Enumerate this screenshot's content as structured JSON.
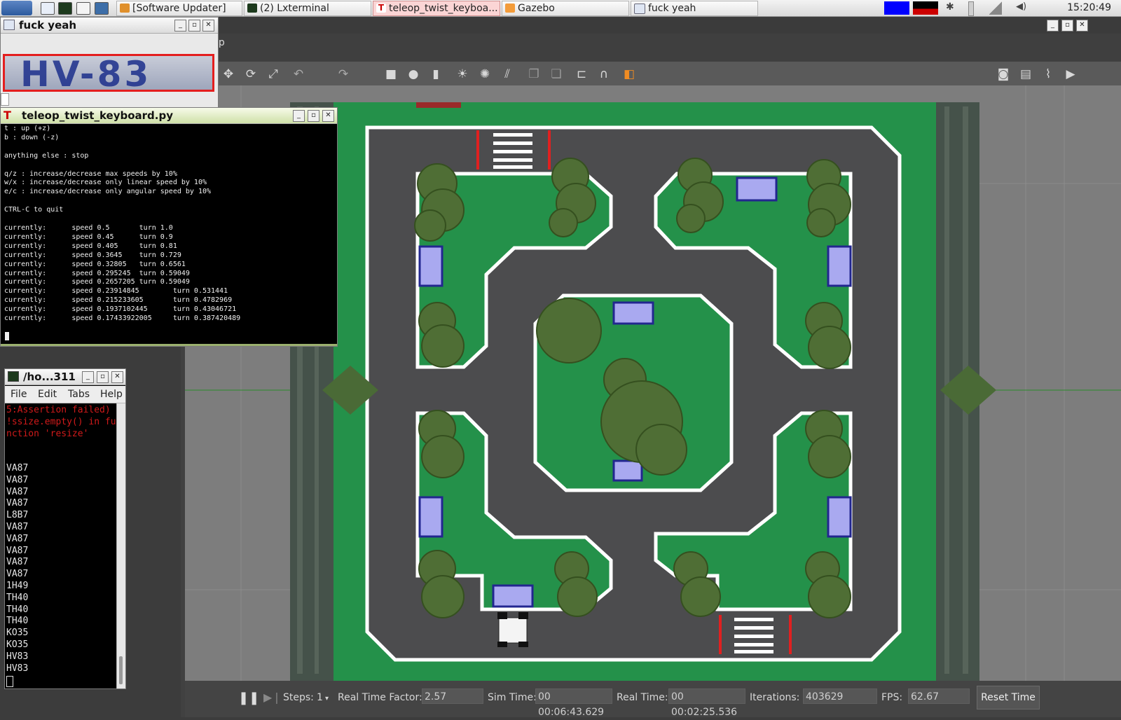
{
  "taskbar": {
    "tasks": [
      {
        "label": "[Software Updater]"
      },
      {
        "label": "(2) Lxterminal"
      },
      {
        "label": "teleop_twist_keyboa..."
      },
      {
        "label": "Gazebo"
      },
      {
        "label": "fuck yeah"
      }
    ],
    "clock": "15:20:49"
  },
  "fy_window": {
    "title": "fuck yeah",
    "plate": "HV-83"
  },
  "teleop": {
    "title": "teleop_twist_keyboard.py",
    "lines": "t : up (+z)\nb : down (-z)\n\nanything else : stop\n\nq/z : increase/decrease max speeds by 10%\nw/x : increase/decrease only linear speed by 10%\ne/c : increase/decrease only angular speed by 10%\n\nCTRL-C to quit\n\ncurrently:      speed 0.5       turn 1.0\ncurrently:      speed 0.45      turn 0.9\ncurrently:      speed 0.405     turn 0.81\ncurrently:      speed 0.3645    turn 0.729\ncurrently:      speed 0.32805   turn 0.6561\ncurrently:      speed 0.295245  turn 0.59049\ncurrently:      speed 0.2657205 turn 0.59049\ncurrently:      speed 0.23914845        turn 0.531441\ncurrently:      speed 0.215233605       turn 0.4782969\ncurrently:      speed 0.1937102445      turn 0.43046721\ncurrently:      speed 0.17433922005     turn 0.387420489"
  },
  "term2": {
    "title": "/ho...311",
    "menu": {
      "file": "File",
      "edit": "Edit",
      "tabs": "Tabs",
      "help": "Help"
    },
    "error": "5:Assertion failed)\n!ssize.empty() in fu\nnction 'resize'",
    "plates": "VA87\nVA87\nVA87\nVA87\nL8B7\nVA87\nVA87\nVA87\nVA87\nVA87\n1H49\nTH40\nTH40\nTH40\nKO35\nKO35\nHV83\nHV83"
  },
  "gazebo": {
    "menu_partial": "lp",
    "steps_label": "Steps:",
    "steps_value": "1",
    "rtf_label": "Real Time Factor:",
    "rtf_value": "2.57",
    "sim_label": "Sim Time:",
    "sim_value": "00 00:06:43.629",
    "real_label": "Real Time:",
    "real_value": "00 00:02:25.536",
    "iter_label": "Iterations:",
    "iter_value": "403629",
    "fps_label": "FPS:",
    "fps_value": "62.67",
    "reset_label": "Reset Time"
  },
  "colors": {
    "grass": "#24914a",
    "road": "#4c4c4e",
    "building": "#a9a9f0",
    "tree": "#4f6e35",
    "plate_border": "#e41e1e"
  }
}
